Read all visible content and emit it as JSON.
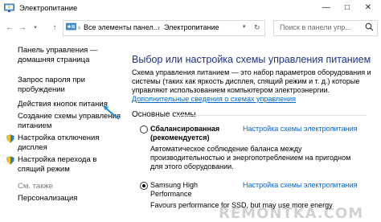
{
  "window": {
    "title": "Электропитание",
    "controls": [
      "—",
      "□",
      "✕"
    ]
  },
  "address": {
    "back_icon": "back-arrow-icon",
    "forward_icon": "forward-arrow-icon",
    "up_icon": "up-arrow-icon",
    "crumbs": [
      "Все элементы панел...",
      "Электропитание"
    ],
    "search_placeholder": "Поиск в панели упр..."
  },
  "sidebar": {
    "items": [
      {
        "label": "Панель управления —",
        "label2": "домашняя страница",
        "icon": "",
        "muted": false
      },
      {
        "label": "Запрос пароля при",
        "label2": "пробуждении",
        "icon": ""
      },
      {
        "label": "Действия кнопок питания",
        "label2": "",
        "icon": ""
      },
      {
        "label": "Создание схемы управления",
        "label2": "питанием",
        "icon": ""
      },
      {
        "label": "Настройка отключения",
        "label2": "дисплея",
        "icon": "shield-icon"
      },
      {
        "label": "Настройка перехода в",
        "label2": "спящий режим",
        "icon": "shield-icon"
      }
    ],
    "see_also": "См. также",
    "personalization": "Персонализация"
  },
  "main": {
    "heading": "Выбор или настройка схемы управления питанием",
    "para_line1": "Схема управления питанием — это набор параметров оборудования и",
    "para_line2": "системы (таких как яркость дисплея, спящий режим и т. д.) которые",
    "para_line3": "управляют использованием компьютером электроэнергии.",
    "para_link": "Дополнительные сведения о схемах управления",
    "section": "Основные схемы",
    "plans": [
      {
        "name1": "Сбалансированная",
        "name2": "(рекомендуется)",
        "selected": false,
        "link": "Настройка схемы электропитания",
        "desc1": "Автоматическое соблюдение баланса между",
        "desc2": "производительностью и энергопотреблением на пригодном",
        "desc3": "для этого оборудовании."
      },
      {
        "name1": "Samsung High",
        "name2": "Performance",
        "selected": true,
        "link": "Настройка схемы электропитания",
        "desc1": "Favours performance for SSD, but may use more energy",
        "desc2": "",
        "desc3": ""
      }
    ]
  },
  "watermark": "REMONTKA.COM",
  "colors": {
    "heading": "#1e3287",
    "link": "#0066cc",
    "arrow": "#1f8fd6"
  }
}
